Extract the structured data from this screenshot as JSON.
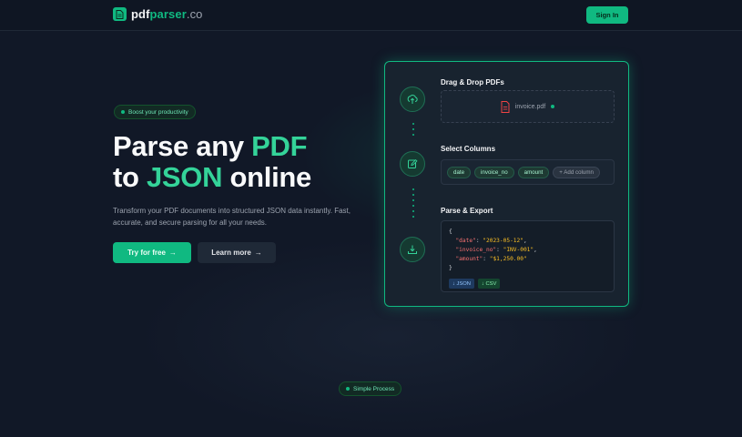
{
  "header": {
    "logo_main": "pdf",
    "logo_accent": "parser",
    "logo_suffix": ".co",
    "signin_label": "Sign In"
  },
  "hero": {
    "badge": "Boost your productivity",
    "headline_line1_a": "Parse any ",
    "headline_line1_b": "PDF",
    "headline_line2_a": "to ",
    "headline_line2_b": "JSON",
    "headline_line2_c": " online",
    "subtitle": "Transform your PDF documents into structured JSON data instantly. Fast, accurate, and secure parsing for all your needs.",
    "primary_cta": "Try for free",
    "secondary_cta": "Learn more"
  },
  "card": {
    "step1": {
      "title": "Drag & Drop PDFs",
      "file_name": "invoice.pdf",
      "icon": "upload-icon"
    },
    "step2": {
      "title": "Select Columns",
      "chips": [
        "date",
        "invoice_no",
        "amount"
      ],
      "add_label": "+ Add column",
      "icon": "edit-icon"
    },
    "step3": {
      "title": "Parse & Export",
      "icon": "download-icon",
      "code_open": "{",
      "rows": [
        {
          "key": "\"date\"",
          "value": "\"2023-05-12\"",
          "trail": ","
        },
        {
          "key": "\"invoice_no\"",
          "value": "\"INV-001\"",
          "trail": ","
        },
        {
          "key": "\"amount\"",
          "value": "\"$1,250.00\"",
          "trail": ""
        }
      ],
      "code_close": "}",
      "export_json": "↓ JSON",
      "export_csv": "↓ CSV"
    }
  },
  "section": {
    "badge": "Simple Process"
  },
  "colors": {
    "accent": "#10b981",
    "background": "#111827",
    "card": "#18232f"
  }
}
